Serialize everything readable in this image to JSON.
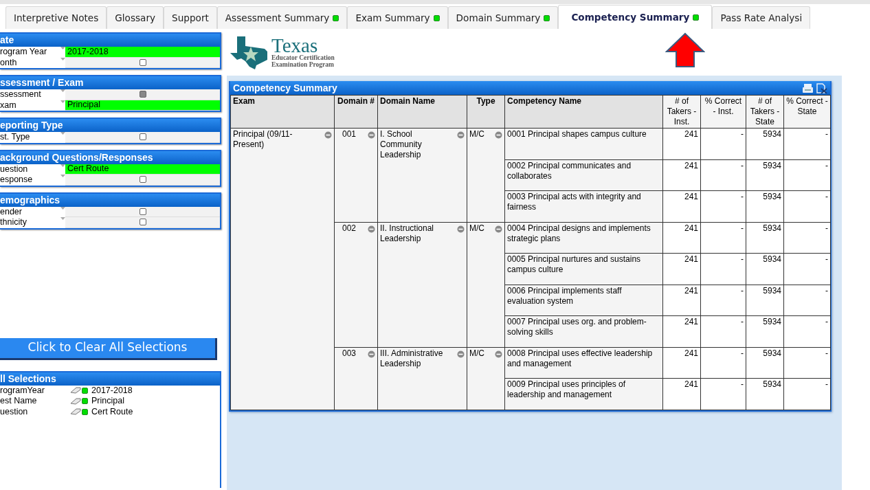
{
  "tabs": [
    {
      "label": "Interpretive Notes",
      "indicator": false,
      "selected": false
    },
    {
      "label": "Glossary",
      "indicator": false,
      "selected": false
    },
    {
      "label": "Support",
      "indicator": false,
      "selected": false
    },
    {
      "label": "Assessment Summary",
      "indicator": true,
      "selected": false
    },
    {
      "label": "Exam Summary",
      "indicator": true,
      "selected": false
    },
    {
      "label": "Domain Summary",
      "indicator": true,
      "selected": false
    },
    {
      "label": "Competency Summary",
      "indicator": true,
      "selected": true
    },
    {
      "label": "Pass Rate Analysi",
      "indicator": false,
      "selected": false
    }
  ],
  "filters": [
    {
      "title": "ate",
      "fields": [
        {
          "label": "rogram Year",
          "kind": "value",
          "value": "2017-2018"
        },
        {
          "label": "onth",
          "kind": "none",
          "checked": false
        }
      ]
    },
    {
      "title": "ssessment / Exam",
      "fields": [
        {
          "label": "ssessment",
          "kind": "locked",
          "checked": false
        },
        {
          "label": "xam",
          "kind": "value",
          "value": "Principal"
        }
      ]
    },
    {
      "title": "eporting Type",
      "fields": [
        {
          "label": "st. Type",
          "kind": "none",
          "checked": false
        }
      ]
    },
    {
      "title": "ackground Questions/Responses",
      "fields": [
        {
          "label": "uestion",
          "kind": "value",
          "value": "Cert Route"
        },
        {
          "label": "esponse",
          "kind": "none",
          "checked": false
        }
      ]
    },
    {
      "title": "emographics",
      "fields": [
        {
          "label": "ender",
          "kind": "none",
          "checked": false
        },
        {
          "label": "thnicity",
          "kind": "none",
          "checked": false
        }
      ]
    }
  ],
  "clear_button": "Click to Clear All Selections",
  "all_selections": {
    "title": "ll Selections",
    "items": [
      {
        "field": "rogramYear",
        "value": "2017-2018"
      },
      {
        "field": "est Name",
        "value": "Principal"
      },
      {
        "field": "uestion",
        "value": "Cert Route"
      }
    ]
  },
  "logo": {
    "name": "Texas",
    "line_1": "Educator Certification",
    "line_2": "Examination Program"
  },
  "competency_summary": {
    "title": "Competency Summary",
    "columns": [
      "Exam",
      "Domain #",
      "Domain Name",
      "Type",
      "Competency Name",
      "# of Takers - Inst.",
      "% Correct - Inst.",
      "# of Takers - State",
      "% Correct - State"
    ],
    "exams": [
      {
        "name": "Principal (09/11-Present)",
        "domains": [
          {
            "number": "001",
            "name": "I. School Community Leadership",
            "type": "M/C",
            "competencies": [
              {
                "name": "0001 Principal shapes campus culture",
                "takers_inst": "241",
                "correct_inst": "-",
                "takers_state": "5934",
                "correct_state": "-"
              },
              {
                "name": "0002 Principal communicates and collaborates",
                "takers_inst": "241",
                "correct_inst": "-",
                "takers_state": "5934",
                "correct_state": "-"
              },
              {
                "name": "0003 Principal acts with integrity and fairness",
                "takers_inst": "241",
                "correct_inst": "-",
                "takers_state": "5934",
                "correct_state": "-"
              }
            ]
          },
          {
            "number": "002",
            "name": "II. Instructional Leadership",
            "type": "M/C",
            "competencies": [
              {
                "name": "0004 Principal designs and implements strategic plans",
                "takers_inst": "241",
                "correct_inst": "-",
                "takers_state": "5934",
                "correct_state": "-"
              },
              {
                "name": "0005 Principal nurtures and sustains campus culture",
                "takers_inst": "241",
                "correct_inst": "-",
                "takers_state": "5934",
                "correct_state": "-"
              },
              {
                "name": "0006 Principal implements staff evaluation system",
                "takers_inst": "241",
                "correct_inst": "-",
                "takers_state": "5934",
                "correct_state": "-"
              },
              {
                "name": "0007 Principal uses org. and problem-solving skills",
                "takers_inst": "241",
                "correct_inst": "-",
                "takers_state": "5934",
                "correct_state": "-"
              }
            ]
          },
          {
            "number": "003",
            "name": "III. Administrative Leadership",
            "type": "M/C",
            "competencies": [
              {
                "name": "0008 Principal uses effective leadership and management",
                "takers_inst": "241",
                "correct_inst": "-",
                "takers_state": "5934",
                "correct_state": "-"
              },
              {
                "name": "0009 Principal uses principles of leadership and management",
                "takers_inst": "241",
                "correct_inst": "-",
                "takers_state": "5934",
                "correct_state": "-"
              }
            ]
          }
        ]
      }
    ]
  }
}
